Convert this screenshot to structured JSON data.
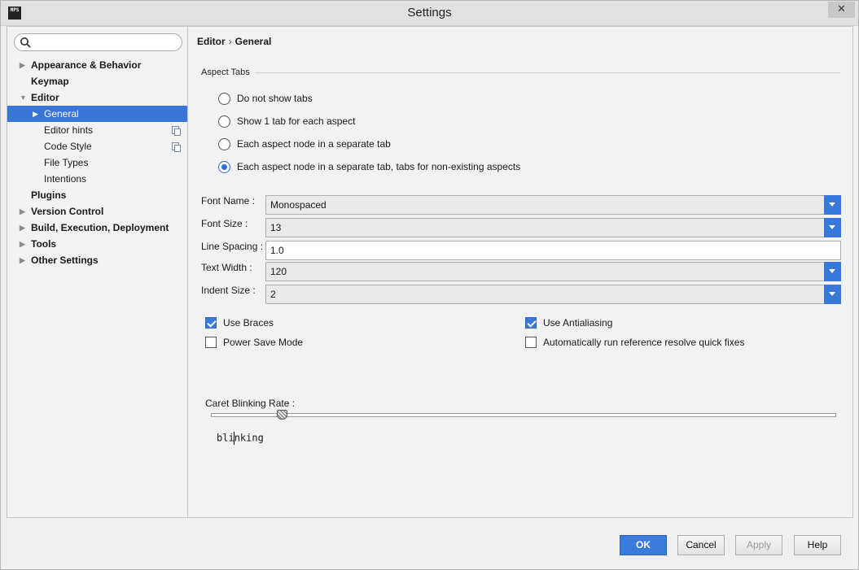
{
  "window": {
    "title": "Settings",
    "app_icon_text": "MPS",
    "close_glyph": "✕"
  },
  "search": {
    "placeholder": ""
  },
  "sidebar": {
    "items": [
      {
        "label": "Appearance & Behavior",
        "level": 0,
        "bold": true,
        "expander": "▶",
        "selected": false,
        "copy_icon": false
      },
      {
        "label": "Keymap",
        "level": 0,
        "bold": true,
        "expander": "",
        "selected": false,
        "copy_icon": false
      },
      {
        "label": "Editor",
        "level": 0,
        "bold": true,
        "expander": "▼",
        "selected": false,
        "copy_icon": false
      },
      {
        "label": "General",
        "level": 1,
        "bold": false,
        "expander": "▶",
        "selected": true,
        "copy_icon": false
      },
      {
        "label": "Editor hints",
        "level": 1,
        "bold": false,
        "expander": "",
        "selected": false,
        "copy_icon": true
      },
      {
        "label": "Code Style",
        "level": 1,
        "bold": false,
        "expander": "",
        "selected": false,
        "copy_icon": true
      },
      {
        "label": "File Types",
        "level": 1,
        "bold": false,
        "expander": "",
        "selected": false,
        "copy_icon": false
      },
      {
        "label": "Intentions",
        "level": 1,
        "bold": false,
        "expander": "",
        "selected": false,
        "copy_icon": false
      },
      {
        "label": "Plugins",
        "level": 0,
        "bold": true,
        "expander": "",
        "selected": false,
        "copy_icon": false
      },
      {
        "label": "Version Control",
        "level": 0,
        "bold": true,
        "expander": "▶",
        "selected": false,
        "copy_icon": false
      },
      {
        "label": "Build, Execution, Deployment",
        "level": 0,
        "bold": true,
        "expander": "▶",
        "selected": false,
        "copy_icon": false
      },
      {
        "label": "Tools",
        "level": 0,
        "bold": true,
        "expander": "▶",
        "selected": false,
        "copy_icon": false
      },
      {
        "label": "Other Settings",
        "level": 0,
        "bold": true,
        "expander": "▶",
        "selected": false,
        "copy_icon": false
      }
    ]
  },
  "breadcrumb": {
    "parent": "Editor",
    "separator": "›",
    "current": "General"
  },
  "aspect_tabs": {
    "label": "Aspect Tabs",
    "options": [
      {
        "label": "Do not show tabs",
        "checked": false
      },
      {
        "label": "Show 1 tab for each aspect",
        "checked": false
      },
      {
        "label": "Each aspect node in a separate tab",
        "checked": false
      },
      {
        "label": "Each aspect node in a separate tab, tabs for non-existing aspects",
        "checked": true
      }
    ]
  },
  "fields": {
    "font_name": {
      "label": "Font Name :",
      "value": "Monospaced"
    },
    "font_size": {
      "label": "Font Size :",
      "value": "13"
    },
    "line_spacing": {
      "label": "Line Spacing :",
      "value": "1.0"
    },
    "text_width": {
      "label": "Text Width :",
      "value": "120"
    },
    "indent_size": {
      "label": "Indent Size :",
      "value": "2"
    }
  },
  "checkboxes": {
    "use_braces": {
      "label": "Use Braces",
      "checked": true
    },
    "power_save": {
      "label": "Power Save Mode",
      "checked": false
    },
    "antialiasing": {
      "label": "Use Antialiasing",
      "checked": true
    },
    "auto_resolve": {
      "label": "Automatically run reference resolve quick fixes",
      "checked": false
    }
  },
  "caret": {
    "label": "Caret Blinking Rate :",
    "slider_value": 0.112,
    "preview_before": "bli",
    "preview_after": "nking"
  },
  "buttons": {
    "ok": "OK",
    "cancel": "Cancel",
    "apply": "Apply",
    "help": "Help"
  }
}
